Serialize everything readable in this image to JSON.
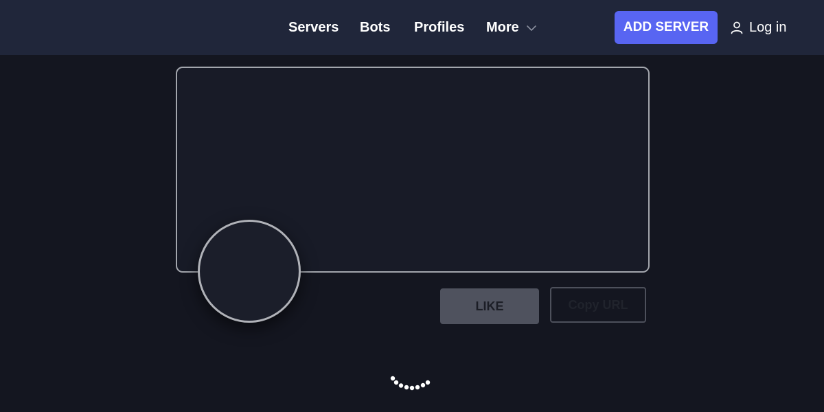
{
  "theme": {
    "accent": "#5865f2",
    "background": "#141620",
    "header_background": "#20263a"
  },
  "nav": {
    "items": [
      {
        "label": "Servers"
      },
      {
        "label": "Bots"
      },
      {
        "label": "Profiles"
      },
      {
        "label": "More",
        "icon": "chevron-down-icon"
      }
    ]
  },
  "header": {
    "add_server_label": "ADD SERVER",
    "login_label": "Log in",
    "login_icon": "user-icon"
  },
  "profile": {
    "like_label": "LIKE",
    "copy_url_label": "Copy URL"
  },
  "loading": {
    "icon": "loading-spinner-icon"
  }
}
